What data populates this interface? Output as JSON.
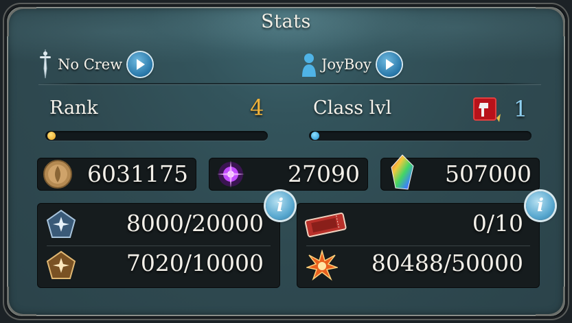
{
  "title": "Stats",
  "crew": {
    "name": "No Crew",
    "icon": "sword-crew-icon"
  },
  "player": {
    "name": "JoyBoy",
    "icon": "player-silhouette-icon"
  },
  "rank": {
    "label": "Rank",
    "value": "4",
    "progress": 0.0,
    "accent": "#e8b238"
  },
  "class_level": {
    "label": "Class lvl",
    "value": "1",
    "progress": 0.0,
    "accent": "#2aa7e0",
    "icon": "axe-class-icon"
  },
  "currencies": [
    {
      "icon": "berry-coin-icon",
      "value": "6031175"
    },
    {
      "icon": "purple-orb-icon",
      "value": "27090"
    },
    {
      "icon": "rainbow-gem-icon",
      "value": "507000"
    }
  ],
  "left_resources": [
    {
      "icon": "blue-pentagon-icon",
      "value": "8000/20000"
    },
    {
      "icon": "gold-pentagon-icon",
      "value": "7020/10000"
    }
  ],
  "right_resources": [
    {
      "icon": "ticket-icon",
      "value": "0/10"
    },
    {
      "icon": "burst-icon",
      "value": "80488/50000"
    }
  ],
  "info_label": "i"
}
